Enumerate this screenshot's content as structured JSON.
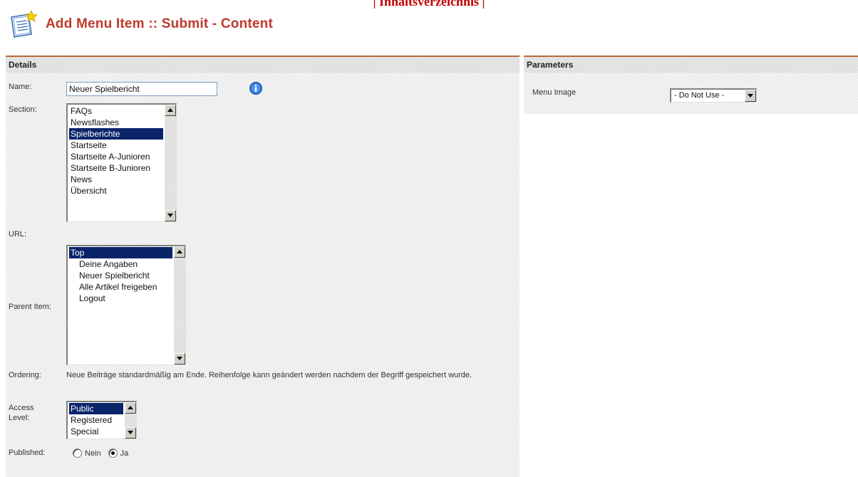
{
  "top_link": "| Inhaltsverzeichnis |",
  "page_title": "Add Menu Item :: Submit - Content",
  "details": {
    "heading": "Details",
    "name_label": "Name:",
    "name_value": "Neuer Spielbericht",
    "section_label": "Section:",
    "sections": [
      "FAQs",
      "Newsflashes",
      "Spielberichte",
      "Startseite",
      "Startseite A-Junioren",
      "Startseite B-Junioren",
      "News",
      "Übersicht"
    ],
    "section_selected": "Spielberichte",
    "url_label": "URL:",
    "parent_label": "Parent Item:",
    "parent_items": [
      "Top",
      "Deine Angaben",
      "Neuer Spielbericht",
      "Alle Artikel freigeben",
      "Logout"
    ],
    "parent_selected": "Top",
    "ordering_label": "Ordering:",
    "ordering_text": "Neue Beiträge standardmäßig am Ende. Reihenfolge kann geändert werden nachdem der Begriff gespeichert wurde.",
    "access_label": "Access Level:",
    "access_levels": [
      "Public",
      "Registered",
      "Special"
    ],
    "access_selected": "Public",
    "published_label": "Published:",
    "published_options": [
      "Nein",
      "Ja"
    ],
    "published_value": "Ja"
  },
  "parameters": {
    "heading": "Parameters",
    "menu_image_label": "Menu Image",
    "menu_image_value": "- Do Not Use -"
  },
  "colors": {
    "title": "#c0392b",
    "top_link": "#c00000",
    "panel_rule": "#c0663a",
    "selection": "#0a246a"
  },
  "icons": {
    "header": "document-star-icon",
    "info": "info-icon"
  }
}
